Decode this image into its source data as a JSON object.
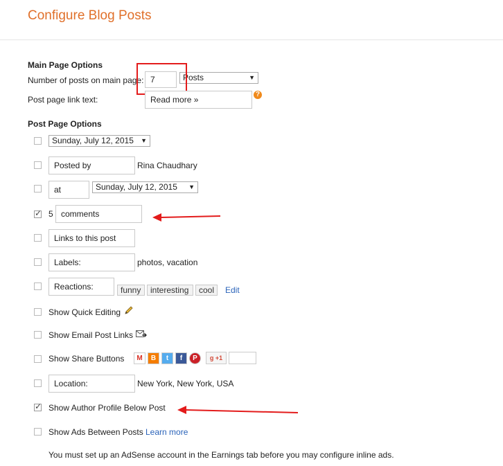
{
  "page_title": "Configure Blog Posts",
  "main_page": {
    "section_title": "Main Page Options",
    "num_posts_label": "Number of posts on main page:",
    "num_posts_value": "7",
    "posts_unit": "Posts",
    "post_link_label": "Post page link text:",
    "post_link_value": "Read more »",
    "help_glyph": "?"
  },
  "post_page": {
    "section_title": "Post Page Options",
    "date_header": "Sunday, July 12, 2015",
    "posted_by_value": "Posted by",
    "author_name": "Rina Chaudhary",
    "at_value": "at",
    "timestamp_value": "Sunday, July 12, 2015",
    "comments_count": "5",
    "comments_value": "comments",
    "links_value": "Links to this post",
    "labels_value": "Labels:",
    "labels_example": "photos, vacation",
    "reactions_value": "Reactions:",
    "reactions": [
      "funny",
      "interesting",
      "cool"
    ],
    "edit_link": "Edit",
    "quick_edit_label": "Show Quick Editing",
    "email_links_label": "Show Email Post Links",
    "share_buttons_label": "Show Share Buttons",
    "share_icons": [
      "M",
      "B",
      "t",
      "f",
      "P",
      "g +1"
    ],
    "location_value": "Location:",
    "location_example": "New York, New York, USA",
    "author_profile_label": "Show Author Profile Below Post",
    "ads_label": "Show Ads Between Posts",
    "learn_more": "Learn more",
    "adsense_note": "You must set up an AdSense account in the Earnings tab before you may configure inline ads."
  },
  "checkboxes": {
    "date_header": false,
    "posted_by": false,
    "timestamp": false,
    "comments": true,
    "links": false,
    "labels": false,
    "reactions": false,
    "quick_edit": false,
    "email_links": false,
    "share_buttons": false,
    "location": false,
    "author_profile": true,
    "ads_between": false
  },
  "colors": {
    "title": "#e0702a",
    "annotation_red": "#e31b1b",
    "link": "#2a63b9"
  }
}
